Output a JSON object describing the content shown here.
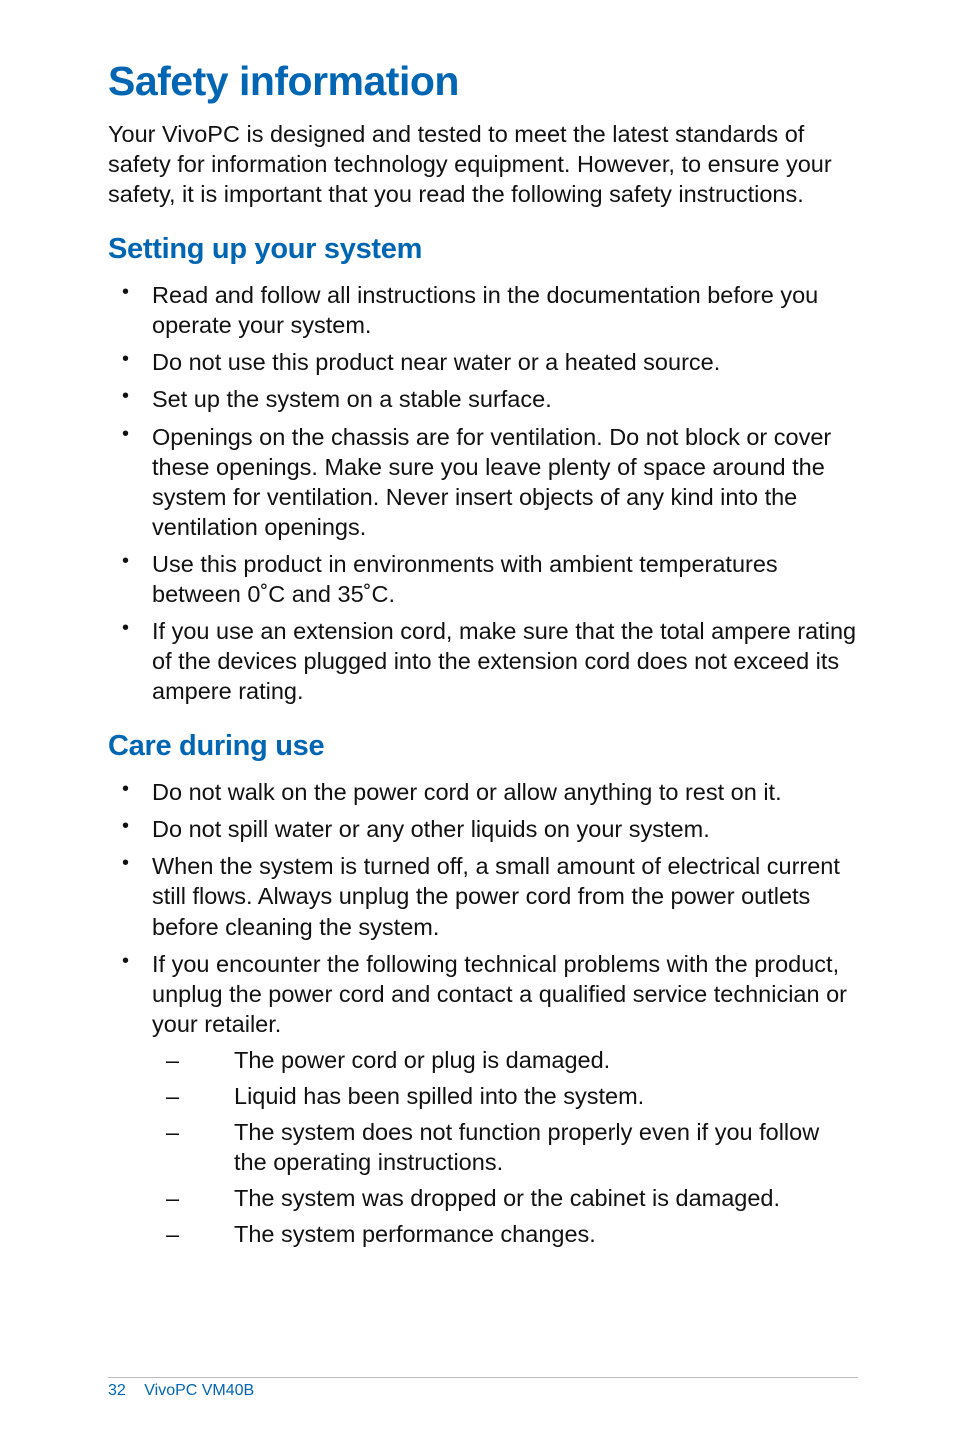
{
  "title": "Safety information",
  "intro": "Your VivoPC is designed and tested to meet the latest standards of safety for information technology equipment. However, to ensure your safety, it is important that you read the following safety instructions.",
  "section1": {
    "heading": "Setting up your system",
    "items": [
      "Read and follow all instructions in the documentation before you operate your system.",
      "Do not use this product near water or a heated source.",
      "Set up the system on a stable surface.",
      "Openings on the chassis are for ventilation. Do not block or cover these openings. Make sure you leave plenty of space around the system for ventilation. Never insert objects of any kind into the ventilation openings.",
      "Use this product in environments with ambient temperatures between 0˚C and 35˚C.",
      "If you use an extension cord, make sure that the total ampere rating of the devices plugged into the extension cord does not exceed its ampere rating."
    ]
  },
  "section2": {
    "heading": "Care during use",
    "items": [
      "Do not walk on the power cord or allow anything to rest on it.",
      "Do not spill water or any other liquids on your system.",
      "When the system is turned off, a small amount of electrical current still flows. Always unplug the power cord from the power outlets before cleaning the system.",
      "If you encounter the following technical problems with the product, unplug the power cord and contact a qualified service technician or your retailer."
    ],
    "subitems": [
      "The power cord or plug is damaged.",
      "Liquid has been spilled into the system.",
      "The system does not function properly even if you follow the operating instructions.",
      "The system was dropped or the cabinet is damaged.",
      "The system performance changes."
    ]
  },
  "footer": {
    "page": "32",
    "product": "VivoPC VM40B"
  }
}
